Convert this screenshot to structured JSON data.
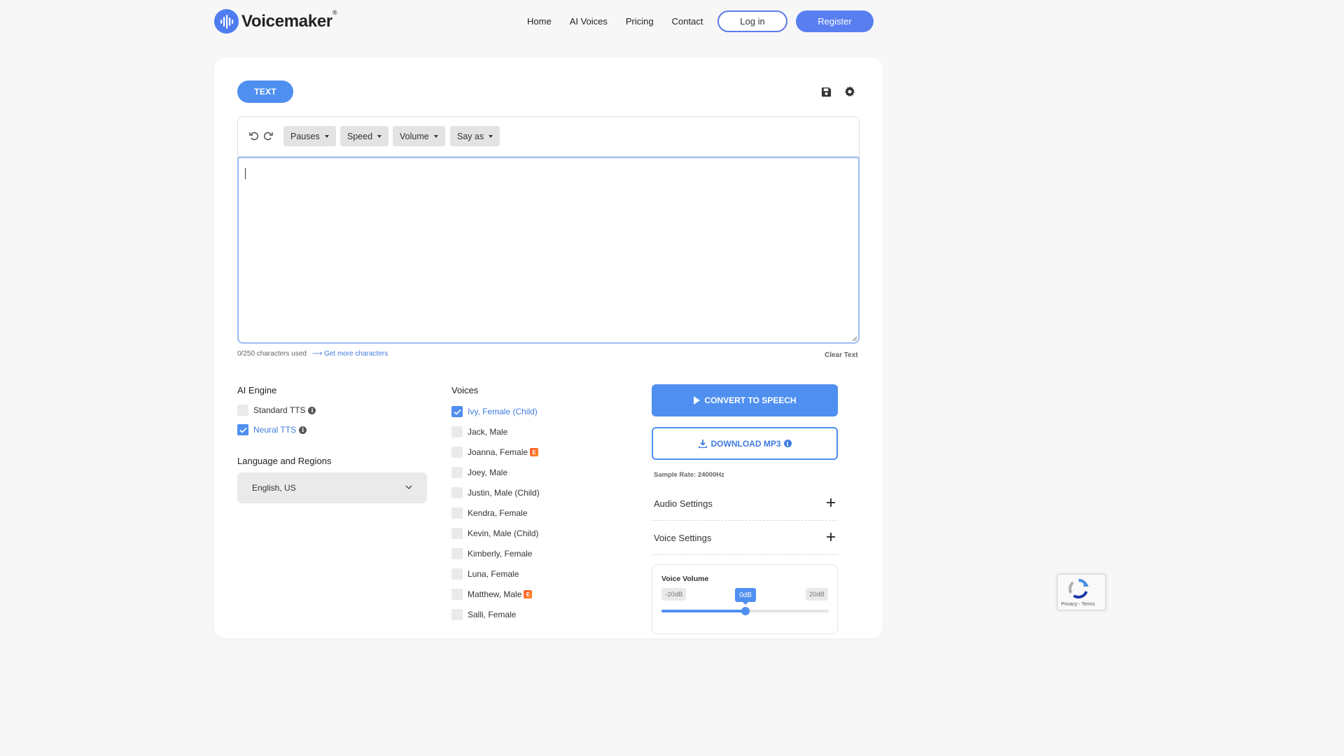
{
  "header": {
    "logo_text": "Voicemaker",
    "logo_reg": "®",
    "nav": [
      "Home",
      "AI Voices",
      "Pricing",
      "Contact"
    ],
    "login_label": "Log in",
    "register_label": "Register"
  },
  "editor": {
    "tab_label": "TEXT",
    "toolbar": [
      "Pauses",
      "Speed",
      "Volume",
      "Say as"
    ],
    "text_value": "",
    "chars_used": "0/250 characters used",
    "more_chars": "⟶ Get more characters",
    "clear_text": "Clear Text"
  },
  "engine": {
    "title": "AI Engine",
    "options": [
      {
        "label": "Standard TTS",
        "checked": false
      },
      {
        "label": "Neural TTS",
        "checked": true
      }
    ]
  },
  "language": {
    "title": "Language and Regions",
    "selected": "English, US"
  },
  "voices": {
    "title": "Voices",
    "items": [
      {
        "label": "Ivy, Female (Child)",
        "checked": true,
        "badge": ""
      },
      {
        "label": "Jack, Male",
        "checked": false,
        "badge": ""
      },
      {
        "label": "Joanna, Female",
        "checked": false,
        "badge": "E"
      },
      {
        "label": "Joey, Male",
        "checked": false,
        "badge": ""
      },
      {
        "label": "Justin, Male (Child)",
        "checked": false,
        "badge": ""
      },
      {
        "label": "Kendra, Female",
        "checked": false,
        "badge": ""
      },
      {
        "label": "Kevin, Male (Child)",
        "checked": false,
        "badge": ""
      },
      {
        "label": "Kimberly, Female",
        "checked": false,
        "badge": ""
      },
      {
        "label": "Luna, Female",
        "checked": false,
        "badge": ""
      },
      {
        "label": "Matthew, Male",
        "checked": false,
        "badge": "E"
      },
      {
        "label": "Salli, Female",
        "checked": false,
        "badge": ""
      }
    ]
  },
  "actions": {
    "convert_label": "CONVERT TO SPEECH",
    "download_label": "DOWNLOAD MP3",
    "sample_rate": "Sample Rate: 24000Hz"
  },
  "settings": {
    "audio_label": "Audio Settings",
    "voice_label": "Voice Settings"
  },
  "volume": {
    "label": "Voice Volume",
    "min_label": "-20dB",
    "max_label": "20dB",
    "current_label": "0dB",
    "min": -20,
    "max": 20,
    "value": 0
  },
  "recaptcha": {
    "links": "Privacy - Terms"
  },
  "colors": {
    "accent": "#4f8ff0",
    "brand": "#587ef0",
    "badge": "#ff6a2a"
  }
}
